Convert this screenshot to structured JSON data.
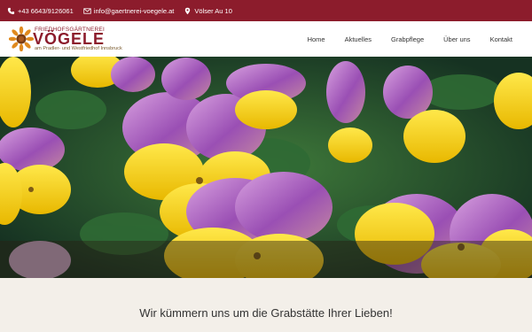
{
  "topbar": {
    "phone": "+43 6643/9126061",
    "email": "info@gaertnerei-voegele.at",
    "address": "Völser Au 10",
    "phone_icon": "phone-icon",
    "email_icon": "envelope-icon",
    "address_icon": "map-pin-icon",
    "background": "#8c1c2c"
  },
  "logo": {
    "line1": "FRIEDHOFSGÄRTNEREI",
    "name": "VÖGELE",
    "line3": "am Pradler- und Westfriedhof Innsbruck",
    "icon": "sunflower-icon",
    "brand_color": "#8c1c2c"
  },
  "nav": {
    "items": [
      "Home",
      "Aktuelles",
      "Grabpflege",
      "Über uns",
      "Kontakt"
    ]
  },
  "hero": {
    "image": "purple-yellow-pansies-photo"
  },
  "tagline": "Wir kümmern uns um die Grabstätte Ihrer Lieben!"
}
